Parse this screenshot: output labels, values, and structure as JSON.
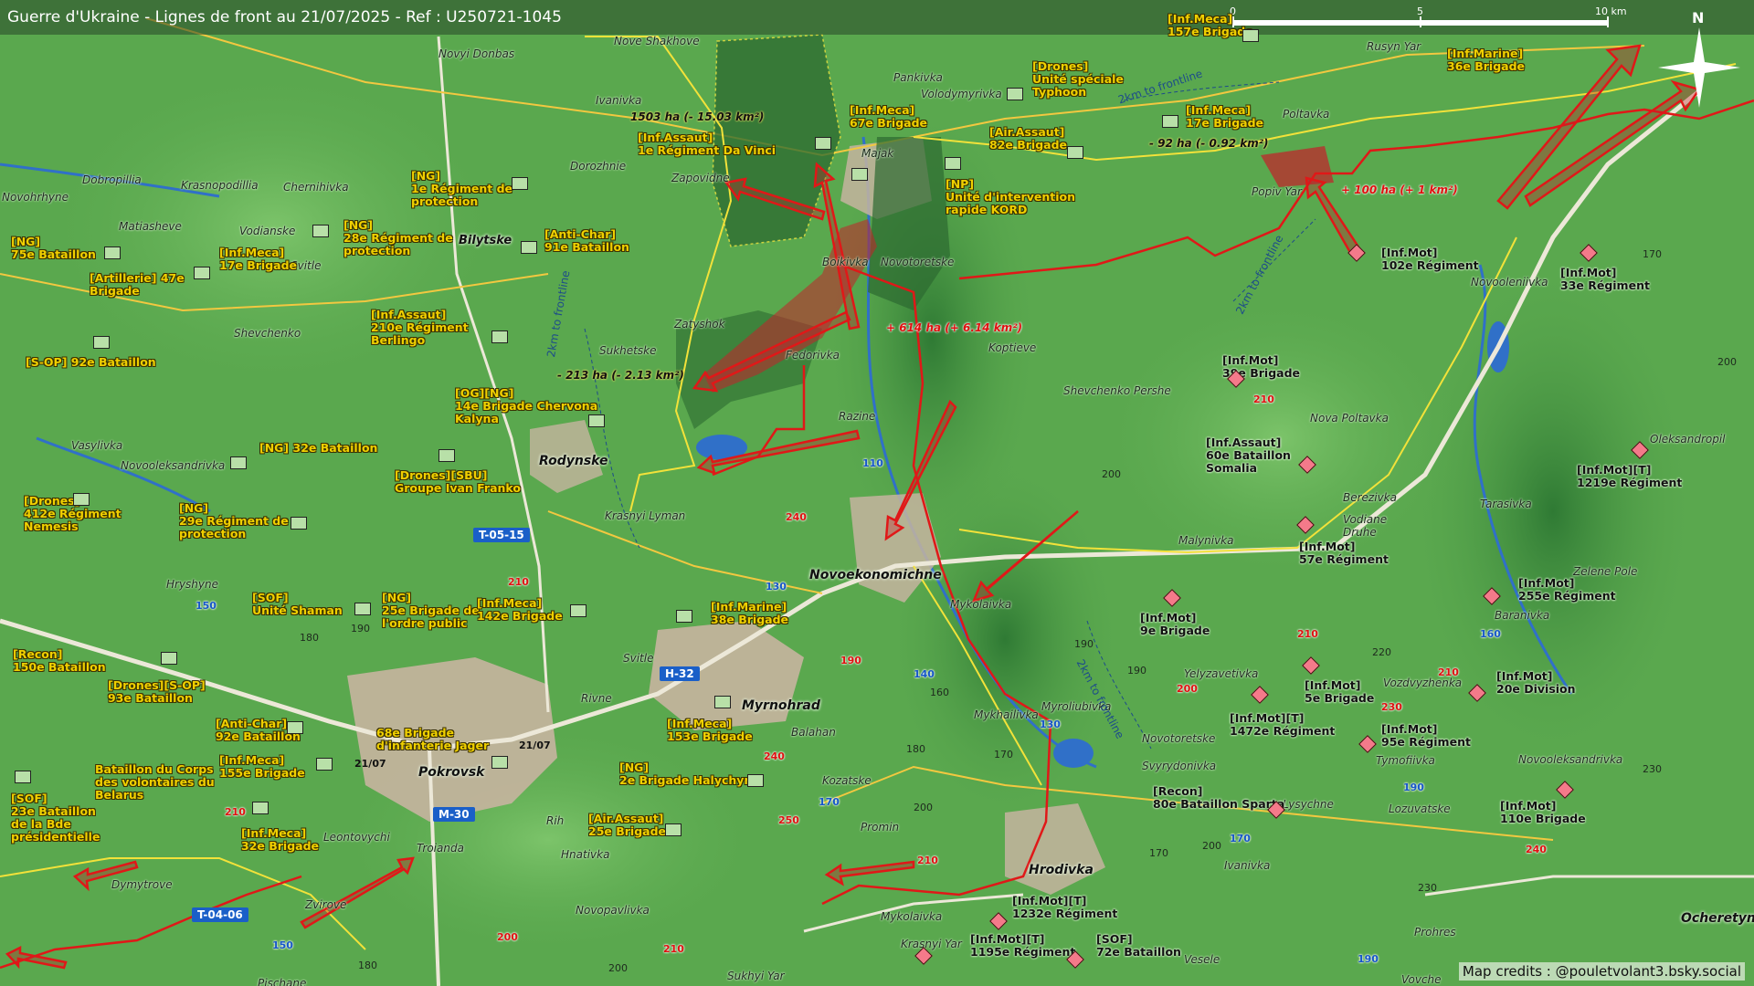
{
  "title": "Guerre d'Ukraine - Lignes de front au 21/07/2025 - Ref : U250721-1045",
  "scale_bar": {
    "ticks": [
      "0",
      "5",
      "10 km"
    ]
  },
  "north_label": "N",
  "credits": "Map credits : @pouletvolant3.bsky.social",
  "colors": {
    "terrain": "#5aa84e",
    "front_ua": "#f2e23a",
    "front_ru": "#e01818",
    "gain": "#c4202a",
    "water": "#3070c8",
    "highway": "#ece8d8"
  },
  "cities": {
    "pokrovsk": "Pokrovsk",
    "myrnohrad": "Myrnohrad",
    "rodynske": "Rodynske",
    "novoekonomichne": "Novoekonomichne",
    "hrodivka": "Hrodivka",
    "ocheretyne": "Ocheretyne"
  },
  "towns": {
    "novyi_donbas": "Novyi Donbas",
    "nove_shakhove": "Nove Shakhove",
    "ivanivka": "Ivanivka",
    "pankivka": "Pankivka",
    "volodymyrivka": "Volodymyrivka",
    "rusyn_yar": "Rusyn Yar",
    "poltavka": "Poltavka",
    "dobropillia": "Dobropillia",
    "krasnopodillia": "Krasnopodillia",
    "chernihivka": "Chernihivka",
    "dorozhnie": "Dorozhnie",
    "zapovidne": "Zapovidne",
    "majak": "Majak",
    "popiv_yar": "Popiv Yar",
    "novohrhyne": "Novohrhyne",
    "matiasheve": "Matiasheve",
    "vodianske": "Vodianske",
    "bilytske": "Bilytske",
    "svitle1": "Svitle",
    "boikivka": "Boikivka",
    "novotoretske": "Novotoretske",
    "novooleniivka": "Novooleniivka",
    "shevchenko": "Shevchenko",
    "zatyshok": "Zatyshok",
    "sukhetske": "Sukhetske",
    "fedorivka": "Fedorivka",
    "koptieve": "Koptieve",
    "shevchenko_pershe": "Shevchenko Pershe",
    "razine": "Razine",
    "nova_poltavka": "Nova Poltavka",
    "vasylivka": "Vasylivka",
    "novooleksandrivka": "Novooleksandrivka",
    "oleksandropil": "Oleksandropil",
    "berezivka": "Berezivka",
    "tarasivka": "Tarasivka",
    "vodiane_druhe": "Vodiane\nDruhe",
    "krasnyi_lyman": "Krasnyi Lyman",
    "malynivka": "Malynivka",
    "zelene_pole": "Zelene Pole",
    "hryshyne": "Hryshyne",
    "mykolaivka1": "Mykolaivka",
    "baranivka": "Baranivka",
    "svitle2": "Svitle",
    "yelyzavetivka": "Yelyzavetivka",
    "vozdvyzhenka": "Vozdvyzhenka",
    "rivne": "Rivne",
    "mykhailivka": "Mykhailivka",
    "myroliubivka": "Myroliubivka",
    "balahan": "Balahan",
    "novotoretske2": "Novotoretske",
    "tymofiivka": "Tymofiivka",
    "kozatske": "Kozatske",
    "svyrydonivka": "Svyrydonivka",
    "novooleksandrivka2": "Novooleksandrivka",
    "lysychne": "Lysychne",
    "lozuvatske": "Lozuvatske",
    "leontovychi": "Leontovychi",
    "troianda": "Troianda",
    "rih": "Rih",
    "promin": "Promin",
    "hnativka": "Hnativka",
    "dymytrove": "Dymytrove",
    "ivanivka2": "Ivanivka",
    "zvirove": "Zvirove",
    "novopavlivka": "Novopavlivka",
    "mykolaivka2": "Mykolaivka",
    "krasnyi_yar": "Krasnyi Yar",
    "veselé": "Vesele",
    "prohres": "Prohres",
    "pischane": "Pischane",
    "sukhyi_yar": "Sukhyi Yar",
    "vovche": "Vovche"
  },
  "front_labels": {
    "f1": "2km to frontline",
    "f2": "2km to frontline",
    "f3": "2km to frontline",
    "f4": "2km to frontline"
  },
  "area_changes": {
    "a1": "1503 ha (- 15.03 km²)",
    "a2": "- 92 ha (- 0.92 km²)",
    "a3": "+ 100 ha (+ 1 km²)",
    "a4": "+ 614 ha (+ 6.14 km²)",
    "a5": "- 213 ha (- 2.13 km²)"
  },
  "ua_units": {
    "u1": "[Inf.Meca]\n157e Brigade",
    "u2": "[Inf.Marine]\n36e Brigade",
    "u3": "[Drones]\nUnité spéciale\nTyphoon",
    "u4": "[Inf.Meca]\n67e Brigade",
    "u5": "[Inf.Meca]\n17e Brigade",
    "u6": "[Inf.Assaut]\n1e Régiment Da Vinci",
    "u7": "[Air.Assaut]\n82e Brigade",
    "u8": "[NP]\nUnité d'intervention\nrapide KORD",
    "u9": "[NG]\n1e Régiment de\nprotection",
    "u10": "[NG]\n28e Régiment de\nprotection",
    "u11": "[Anti-Char]\n91e Bataillon",
    "u12": "[NG]\n75e Bataillon",
    "u13": "[Inf.Meca]\n17e Brigade",
    "u14": "[Artillerie] 47e\nBrigade",
    "u15": "[Inf.Assaut]\n210e Régiment\nBerlingo",
    "u16": "[S-OP] 92e Bataillon",
    "u17": "[OG][NG]\n14e Brigade Chervona\nKalyna",
    "u18": "[NG] 32e Bataillon",
    "u19": "[Drones][SBU]\nGroupe Ivan Franko",
    "u20": "[Drones]\n412e Régiment\nNemesis",
    "u21": "[NG]\n29e Régiment de\nprotection",
    "u22": "[SOF]\nUnité Shaman",
    "u23": "[NG]\n25e Brigade de\nl'ordre public",
    "u24": "[Inf.Meca]\n142e Brigade",
    "u25": "[Inf.Marine]\n38e Brigade",
    "u26": "[Recon]\n150e Bataillon",
    "u27": "[Drones][S-OP]\n93e Bataillon",
    "u28": "[Anti-Char]\n92e Bataillon",
    "u29": "68e Brigade\nd'infanterie Jager",
    "u30": "Bataillon du Corps\ndes volontaires du\nBelarus",
    "u31": "[Inf.Meca]\n155e Brigade",
    "u32": "[Inf.Meca]\n153e Brigade",
    "u33": "[NG]\n2e Brigade Halychyna",
    "u34": "[SOF]\n23e Bataillon\nde la Bde\nprésidentielle",
    "u35": "[Inf.Meca]\n32e Brigade",
    "u36": "[Air.Assaut]\n25e Brigade"
  },
  "ru_units": {
    "r1": "[Inf.Mot]\n102e Régiment",
    "r2": "[Inf.Mot]\n33e Régiment",
    "r3": "[Inf.Mot]\n39e Brigade",
    "r4": "[Inf.Assaut]\n60e Bataillon\nSomalia",
    "r5": "[Inf.Mot][T]\n1219e Régiment",
    "r6": "[Inf.Mot]\n57e Régiment",
    "r7": "[Inf.Mot]\n255e Régiment",
    "r8": "[Inf.Mot]\n9e Brigade",
    "r9": "[Inf.Mot]\n5e Brigade",
    "r10": "[Inf.Mot]\n20e Division",
    "r11": "[Inf.Mot][T]\n1472e Régiment",
    "r12": "[Inf.Mot]\n95e Régiment",
    "r13": "[Recon]\n80e Bataillon Sparta",
    "r14": "[Inf.Mot]\n110e Brigade",
    "r15": "[Inf.Mot][T]\n1232e Régiment",
    "r16": "[Inf.Mot][T]\n1195e Régiment",
    "r17": "[SOF]\n72e Bataillon"
  },
  "road_shields": {
    "t0515": "T-05-15",
    "h32": "H-32",
    "m30": "M-30",
    "t0406": "T-04-06"
  },
  "road_numbers": {
    "n110": "110",
    "n240a": "240",
    "n210a": "210",
    "n130a": "130",
    "n150a": "150",
    "n180a": "180",
    "n190a": "190",
    "n190b": "190",
    "n140": "140",
    "n160": "160",
    "n170a": "170",
    "n200a": "200",
    "n210b": "210",
    "n230a": "230",
    "n240b": "240",
    "n250": "250",
    "n210c": "210",
    "n200b": "200",
    "n180b": "180",
    "n200c": "200",
    "n210d": "210",
    "n170b": "170",
    "n190c": "190",
    "n170c": "170",
    "n190d": "190",
    "n220": "220",
    "n230b": "230",
    "n240c": "240",
    "n200d": "200",
    "n170d": "170",
    "n200e": "200",
    "n210e": "210",
    "n160b": "160",
    "n190e": "190",
    "n150b": "150",
    "n180c": "180",
    "n200f": "200",
    "n230c": "230",
    "n200g": "200",
    "n170e": "170",
    "n210f": "210",
    "n210g": "210",
    "n130b": "130",
    "n190f": "190"
  },
  "date_labels": {
    "d1": "21/07",
    "d2": "21/07"
  }
}
